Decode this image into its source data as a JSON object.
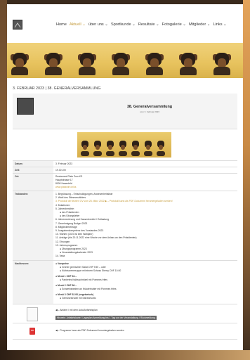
{
  "nav": {
    "items": [
      "Home",
      "Aktuell ⌄",
      "über uns ⌄",
      "Sportkunde ⌄",
      "Resultate ⌄",
      "Fotogalerie ⌄",
      "Mitglieder ⌄",
      "Links ⌄"
    ],
    "active_index": 1
  },
  "post": {
    "title": "3. FEBRUAR 2023 | 38. GENERALVERSAMMLUNG"
  },
  "event": {
    "title": "38. Generalversammlung",
    "subtitle": "vom 3. Februar 2023"
  },
  "details": {
    "datum_label": "Datum:",
    "datum_value": "3. Februar 2023",
    "zeit_label": "Zeit:",
    "zeit_value": "19.30 Uhr",
    "ort_label": "Ort:",
    "ort_lines": [
      "Restaurant Platz Zum KS",
      "Hauptstrasse 17",
      "8000 Hasenfeld"
    ],
    "ort_link": "www.platzwirt.ch/ks",
    "trakt_label": "Traktanden:",
    "trakt_items": [
      "1. Begrüssung – Entschuldigungen, Anwesenheitsliste",
      "2. Wahl des Stimmenzählers",
      "3. Protokoll der letzten GV vom 28. März 2022 ▶ – Protokoll kann als PDF-Dokument heruntergeladen werden!",
      "4. Mutationen",
      "5. Jahresberichte:",
      "  ● des Präsidenten",
      "  ● des Übungsleiter",
      "6. Jahresrechnung und Kassenbericht / Entlastung",
      "7. Genehmigung Budget 2023",
      "8. Mitgliederbeiträge",
      "9. Ausgabenkompetenz des Vorstandes 2023",
      "10. Wahlen (2023 ist kein Wahljahr)",
      "11. Anträge (bis 20.11.2022 eine Woche vor dem Anlass an den Präsidenten)",
      "12. Ehrungen",
      "13. Jahresprogramm",
      "  ● Übungsprogramm 2023",
      "  ● Veranstaltungskalender 2023",
      "14. Varia"
    ],
    "nacht_label": "Nachtessen:",
    "menus": [
      {
        "title": "● Vorspeise",
        "items": [
          "● Grüner gemischter Salat  CHF 9.50 – oder",
          "● Kürbiscremesuppe mit einem Schuss Sherry CHF 10.00"
        ]
      },
      {
        "title": "● Menü 1 CHF 33.–",
        "items": [
          "● Paniertes Kalbsschnitzel mit Pommes frites"
        ]
      },
      {
        "title": "● Menü 2 CHF 36.–",
        "items": [
          "● Schweinsbraten an Kräuterbutter mit Pommes frites"
        ]
      },
      {
        "title": "● Menü 3 CHF 32.00 (vegetarisch)",
        "items": [
          "● Gemüsestrudel mit Safranrisotto"
        ]
      }
    ],
    "att1_text": "◀ – Anfahrt / mit dem Auto/Anfahrtsplan",
    "att1_bar": "Hinweis: Anfahrtskarte / Lageplan Anmeldung bis 1 Tag vor der Veranstaltung / Rückmeldung",
    "att2_text": "◀ – Programm kann als PDF-Dokument heruntergeladen werden"
  }
}
